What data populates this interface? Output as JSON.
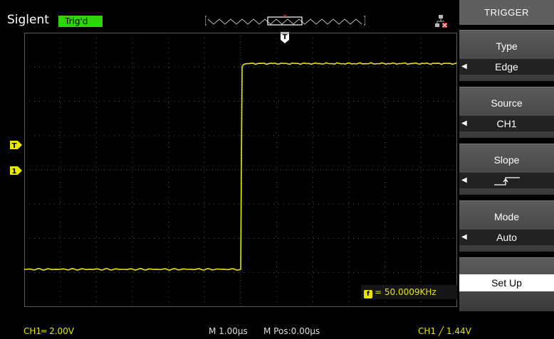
{
  "header": {
    "brand": "Siglent",
    "trigger_status": "Trig'd"
  },
  "icons": {
    "memory_bar": "memory-window-icon",
    "network": "network-disconnected-icon",
    "trigger_position": "trigger-position-marker-icon",
    "trigger_level_marker": "trigger-level-marker-icon",
    "channel_marker": "channel1-ground-marker-icon",
    "frequency": "frequency-counter-icon"
  },
  "markers": {
    "trigger_pos": "T",
    "trigger_level": "T",
    "ch1": "1"
  },
  "measurement": {
    "frequency": "= 50.0009KHz",
    "icon": "f"
  },
  "status_bar": {
    "ch1_scale": "CH1═ 2.00V",
    "timebase": "M 1.00µs",
    "main_position": "M Pos:0.00µs",
    "trigger": "CH1 ╱ 1.44V"
  },
  "menu": {
    "title": "TRIGGER",
    "items": [
      {
        "label": "Type",
        "value": "Edge"
      },
      {
        "label": "Source",
        "value": "CH1"
      },
      {
        "label": "Slope",
        "value": ""
      },
      {
        "label": "Mode",
        "value": "Auto"
      }
    ],
    "setup_label": "Set Up"
  },
  "colors": {
    "ch1": "#e6e600",
    "trigger_badge": "#2fd40a",
    "grid": "#5a5a5a",
    "background": "#000000"
  },
  "trace": {
    "channel": "CH1",
    "waveform": "rising-edge",
    "low_level_div": -2.9,
    "high_level_div": 3.1,
    "edge_time_div": 0.0
  }
}
